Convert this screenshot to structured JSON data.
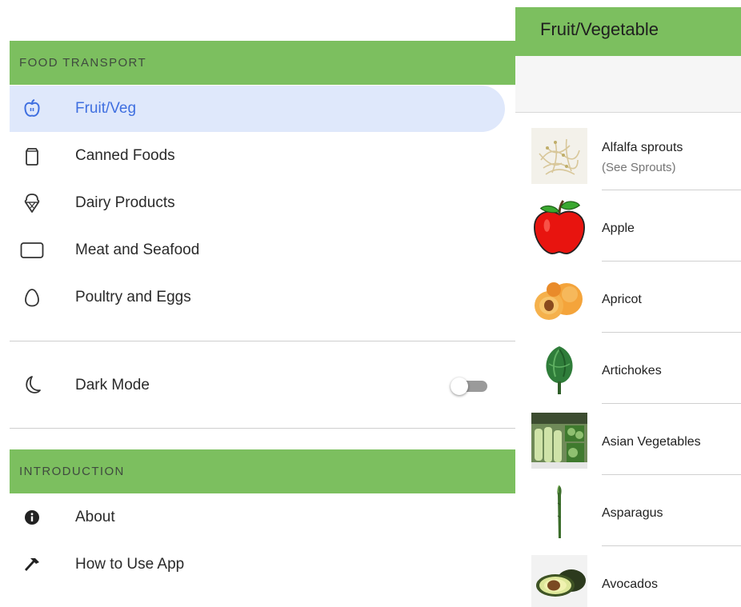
{
  "menu": {
    "sections": [
      {
        "header": "FOOD TRANSPORT"
      },
      {
        "header": "INTRODUCTION"
      }
    ],
    "food_items": [
      {
        "label": "Fruit/Veg",
        "icon": "apple-icon",
        "active": true
      },
      {
        "label": "Canned Foods",
        "icon": "can-icon"
      },
      {
        "label": "Dairy Products",
        "icon": "ice-cream-icon"
      },
      {
        "label": "Meat and Seafood",
        "icon": "tablet-icon"
      },
      {
        "label": "Poultry and Eggs",
        "icon": "egg-icon"
      }
    ],
    "dark_mode": {
      "label": "Dark Mode",
      "icon": "moon-icon",
      "enabled": false
    },
    "intro_items": [
      {
        "label": "About",
        "icon": "info-icon"
      },
      {
        "label": "How to Use App",
        "icon": "hammer-icon"
      }
    ],
    "active_color": "#3f6fe0",
    "active_bg": "#dfe8fb",
    "header_color": "#7cbf5f"
  },
  "page": {
    "title": "Fruit/Vegetable",
    "items": [
      {
        "title": "Alfalfa sprouts",
        "subtitle": "(See Sprouts)",
        "image": "sprouts-image"
      },
      {
        "title": "Apple",
        "image": "apple-image"
      },
      {
        "title": "Apricot",
        "image": "apricot-image"
      },
      {
        "title": "Artichokes",
        "image": "artichoke-image"
      },
      {
        "title": "Asian Vegetables",
        "image": "asian-vegetables-image"
      },
      {
        "title": "Asparagus",
        "image": "asparagus-image"
      },
      {
        "title": "Avocados",
        "image": "avocado-image"
      }
    ]
  }
}
